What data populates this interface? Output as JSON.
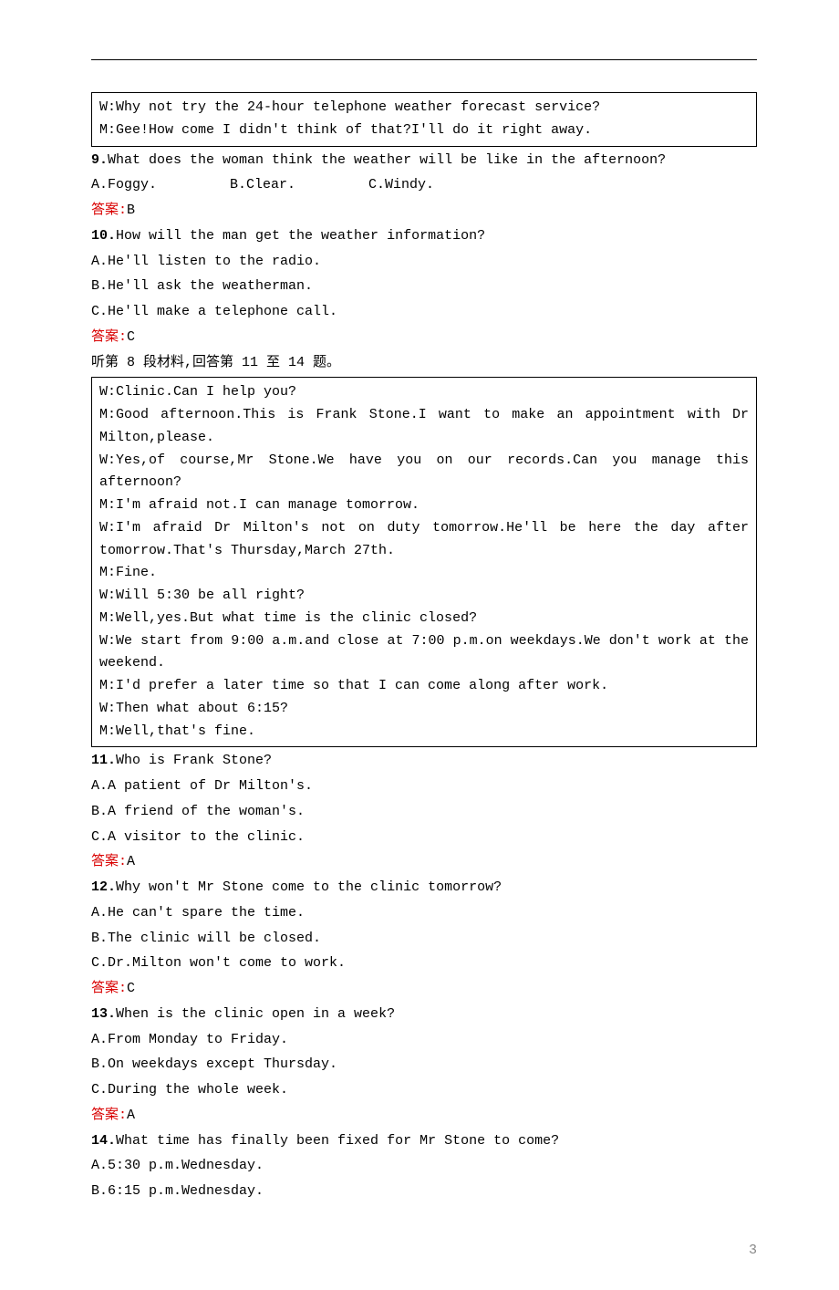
{
  "box1": {
    "l1": "W:Why not try the 24-hour telephone weather forecast service?",
    "l2": "M:Gee!How come I didn't think of that?I'll do it right away."
  },
  "q9": {
    "num": "9.",
    "text": "What does the woman think the weather will be like in the afternoon?",
    "a": "A.Foggy.",
    "b": "B.Clear.",
    "c": "C.Windy.",
    "ansLabel": "答案:",
    "ans": "B"
  },
  "q10": {
    "num": "10.",
    "text": "How will the man get the weather information?",
    "a": "A.He'll listen to the radio.",
    "b": "B.He'll ask the weatherman.",
    "c": "C.He'll make a telephone call.",
    "ansLabel": "答案:",
    "ans": "C"
  },
  "sec8": "听第 8 段材料,回答第 11 至 14 题。",
  "box2": {
    "l1": "W:Clinic.Can I help you?",
    "l2": "M:Good afternoon.This is Frank Stone.I want to make an appointment with Dr Milton,please.",
    "l3": "W:Yes,of course,Mr Stone.We have you on our records.Can you manage this afternoon?",
    "l4": "M:I'm afraid not.I can manage tomorrow.",
    "l5": "W:I'm afraid Dr Milton's not on duty tomorrow.He'll be here the day after tomorrow.That's Thursday,March 27th.",
    "l6": "M:Fine.",
    "l7": "W:Will 5:30 be all right?",
    "l8": "M:Well,yes.But what time is the clinic closed?",
    "l9": "W:We start from 9:00 a.m.and close at 7:00 p.m.on weekdays.We don't work at the weekend.",
    "l10": "M:I'd prefer a later time so that I can come along after work.",
    "l11": "W:Then what about 6:15?",
    "l12": "M:Well,that's fine."
  },
  "q11": {
    "num": "11.",
    "text": "Who is Frank Stone?",
    "a": "A.A patient of Dr Milton's.",
    "b": "B.A friend of the woman's.",
    "c": "C.A visitor to the clinic.",
    "ansLabel": "答案:",
    "ans": "A"
  },
  "q12": {
    "num": "12.",
    "text": "Why won't Mr Stone come to the clinic tomorrow?",
    "a": "A.He can't spare the time.",
    "b": "B.The clinic will be closed.",
    "c": "C.Dr.Milton won't come to work.",
    "ansLabel": "答案:",
    "ans": "C"
  },
  "q13": {
    "num": "13.",
    "text": "When is the clinic open in a week?",
    "a": "A.From Monday to Friday.",
    "b": "B.On weekdays except Thursday.",
    "c": "C.During the whole week.",
    "ansLabel": "答案:",
    "ans": "A"
  },
  "q14": {
    "num": "14.",
    "text": "What time has finally been fixed for Mr Stone to come?",
    "a": "A.5:30 p.m.Wednesday.",
    "b": "B.6:15 p.m.Wednesday."
  },
  "pageNumber": "3"
}
